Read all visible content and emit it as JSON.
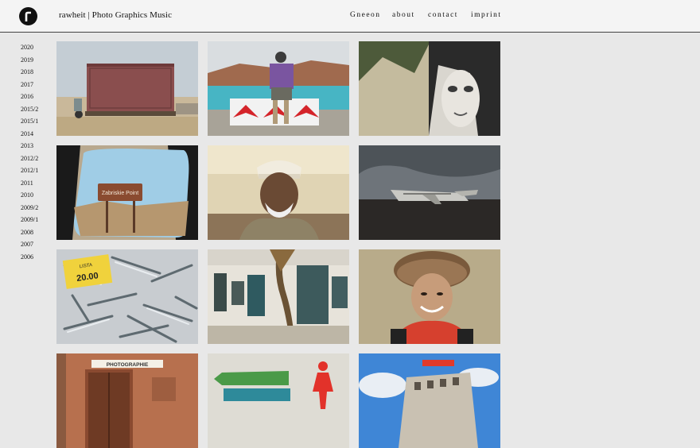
{
  "header": {
    "brand": "rawheit | Photo Graphics Music",
    "nav": [
      "Gneeon",
      "about",
      "contact",
      "imprint"
    ]
  },
  "years": [
    "2020",
    "2019",
    "2018",
    "2017",
    "2016",
    "2015/2",
    "2015/1",
    "2014",
    "2013",
    "2012/2",
    "2012/1",
    "2011",
    "2010",
    "2009/2",
    "2009/1",
    "2008",
    "2007",
    "2006"
  ],
  "photos": {
    "sign_text": "Zabriskie Point",
    "fish_price": "20.00",
    "fish_label": "LISTA",
    "studio_sign": "PHOTOGRAPHIE"
  }
}
